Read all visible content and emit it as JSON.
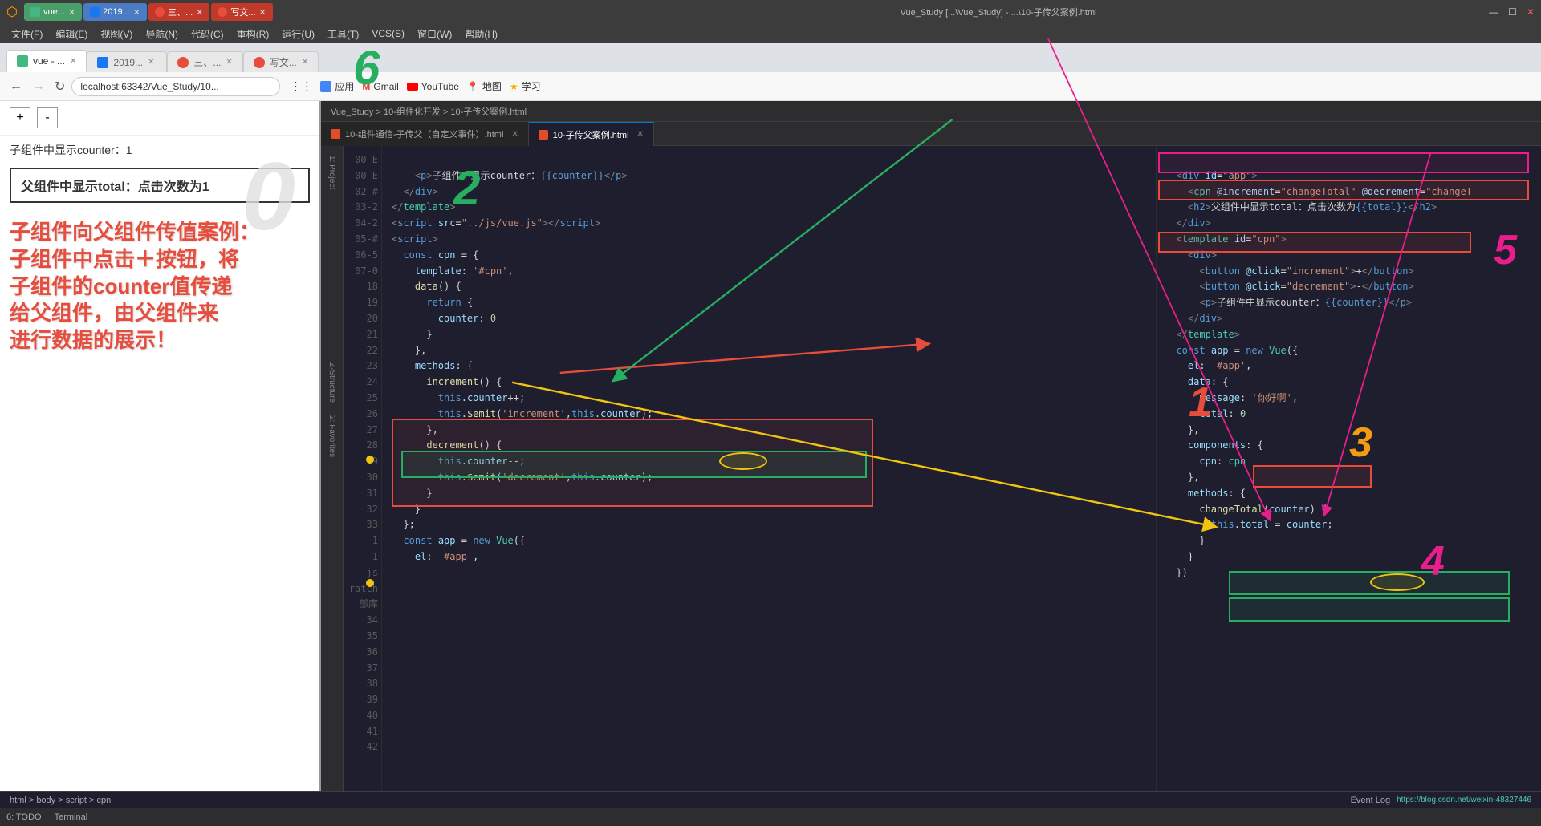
{
  "window": {
    "title": "Vue_Study [...\\Vue_Study] - ...\\10-子传父案例.html",
    "controls": [
      "—",
      "☐",
      "✕"
    ]
  },
  "title_bar": {
    "icon": "⬡",
    "tabs": [
      {
        "label": "vue...",
        "active": false,
        "icon": "vue"
      },
      {
        "label": "2019...",
        "active": false,
        "icon": "2019"
      },
      {
        "label": "三、...",
        "active": false,
        "icon": "c"
      },
      {
        "label": "写文...",
        "active": false,
        "icon": "c"
      }
    ]
  },
  "menu": {
    "items": [
      "文件(F)",
      "编辑(E)",
      "视图(V)",
      "导航(N)",
      "代码(C)",
      "重构(R)",
      "运行(U)",
      "工具(T)",
      "VCS(S)",
      "窗口(W)",
      "帮助(H)"
    ]
  },
  "browser": {
    "address": "localhost:63342/Vue_Study/10...",
    "bookmarks": [
      {
        "label": "应用",
        "icon": "apps"
      },
      {
        "label": "Gmail",
        "icon": "gmail"
      },
      {
        "label": "YouTube",
        "icon": "youtube"
      },
      {
        "label": "地图",
        "icon": "maps"
      },
      {
        "label": "学习",
        "icon": "learn"
      }
    ],
    "tabs": [
      {
        "label": "vue - ...",
        "active": false
      },
      {
        "label": "2019...",
        "active": false
      },
      {
        "label": "三、...",
        "active": false
      },
      {
        "label": "写文...",
        "active": false
      }
    ]
  },
  "browser_content": {
    "plus_btn": "+",
    "minus_btn": "-",
    "zero_label": "0",
    "child_counter": "子组件中显示counter：1",
    "parent_total": "父组件中显示total：点击次数为1",
    "annotation": "子组件向父组件传值案例：\n子组件中点击＋按钮，将\n子组件的counter值传递\n给父组件，由父组件来\n进行数据的展示！"
  },
  "ide": {
    "breadcrumb": "Vue_Study > 10-组件化开发 > 10-子传父案例.html",
    "file_tabs": [
      {
        "label": "10-组件通信-子传父（自定义事件）.html",
        "active": false
      },
      {
        "label": "10-子传父案例.html",
        "active": true
      }
    ],
    "left_lines": [
      "18",
      "19",
      "20",
      "21",
      "22",
      "23",
      "24",
      "25",
      "26",
      "27",
      "28",
      "29",
      "30",
      "31",
      "32",
      "33",
      "34",
      "35",
      "36",
      "37",
      "38",
      "39",
      "40",
      "41",
      "42"
    ],
    "left_code": [
      "    <p>子组件中显示counter：{{counter}}</p>",
      "  </div>",
      "</template>",
      "<script src=\"../js/vue.js\"></script>",
      "<script>",
      "  const cpn = {",
      "    template: '#cpn',",
      "    data() {",
      "      return {",
      "        counter: 0",
      "      }",
      "    },",
      "    methods: {",
      "      increment() {",
      "        this.counter++;",
      "        this.$emit('increment',this.counter);",
      "      },",
      "      decrement() {",
      "        this.counter--;",
      "        this.$emit('decrement',this.counter);",
      "      }",
      "    }",
      "  };",
      "  const app = new Vue({",
      "    el: '#app',"
    ],
    "right_lines": [
      ""
    ],
    "right_code_top": [
      "  <div id=\"app\">",
      "    <cpn @increment=\"changeTotal\" @decrement=\"changeT",
      "    <h2>父组件中显示total：点击次数为{{total}}</h2>",
      "  </div>",
      "  <template id=\"cpn\">",
      "    <div>",
      "      <button @click=\"increment\">+</button>",
      "      <button @click=\"decrement\">-</button>",
      "      <p>子组件中显示counter：{{counter}}</p>",
      "    </div>",
      "  </template>",
      "  const app = new Vue({",
      "    el: '#app',",
      "    data: {",
      "      message: '你好啊',",
      "      total: 0",
      "    },",
      "    components: {",
      "      cpn: cpn",
      "    },",
      "    methods: {",
      "      changeTotal(counter) {",
      "        this.total = counter;",
      "      }",
      "    }",
      "  })"
    ]
  },
  "numbers": {
    "n0": "0",
    "n1": "1",
    "n2": "2",
    "n3": "3",
    "n4": "4",
    "n5": "5",
    "n6": "6"
  },
  "status_bar": {
    "todo": "6: TODO",
    "terminal": "Terminal",
    "event_log": "Event Log",
    "bottom_right": "https://blog.csdn.net/weixin-48327446"
  },
  "breadcrumb_bottom": "html > body > script > cpn"
}
